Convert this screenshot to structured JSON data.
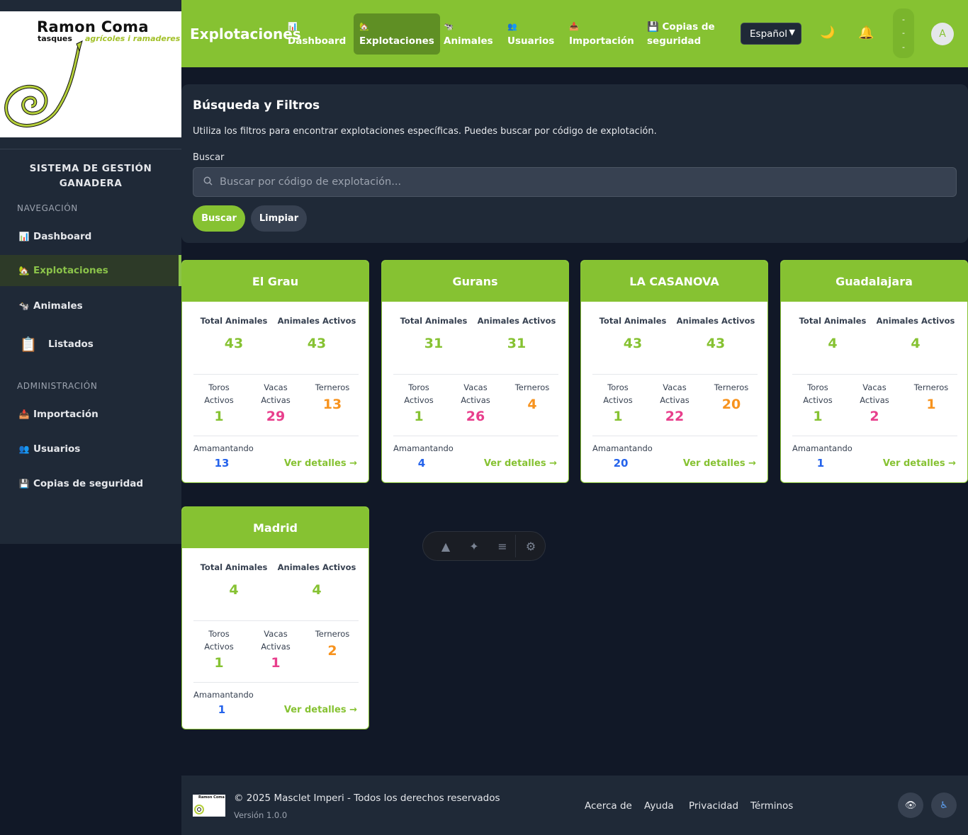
{
  "brand": {
    "name": "Ramon Coma",
    "tagline_left": "tasques",
    "tagline_right": "agrícoles i ramaderes",
    "colors": {
      "green": "#86c232",
      "dark": "#111827",
      "panel": "#1f2937"
    }
  },
  "sidebar": {
    "system_title_line1": "SISTEMA DE GESTIÓN",
    "system_title_line2": "GANADERA",
    "section_nav": "NAVEGACIÓN",
    "section_admin": "ADMINISTRACIÓN",
    "items": [
      {
        "label": "Dashboard",
        "icon": "📊"
      },
      {
        "label": "Explotaciones",
        "icon": "🏡"
      },
      {
        "label": "Animales",
        "icon": "🐄"
      },
      {
        "label": "Listados",
        "icon": "📋"
      },
      {
        "label": "Importación",
        "icon": "📥"
      },
      {
        "label": "Usuarios",
        "icon": "👥"
      },
      {
        "label": "Copias de seguridad",
        "icon": "💾"
      }
    ]
  },
  "header": {
    "title": "Explotaciones",
    "nav": [
      {
        "line1": "📊",
        "line2": "Dashboard"
      },
      {
        "line1": "🏡",
        "line2": "Explotaciones"
      },
      {
        "line1": "🐄",
        "line2": "Animales"
      },
      {
        "line1": "👥",
        "line2": "Usuarios"
      },
      {
        "line1": "📥",
        "line2": "Importación"
      },
      {
        "line1": "💾 Copias de",
        "line2": "seguridad"
      }
    ],
    "language": "Español",
    "moon_icon": "🌙",
    "bell_icon": "🔔",
    "pill_dots": [
      "-",
      "-",
      "-"
    ],
    "avatar_letter": "A"
  },
  "filters": {
    "title": "Búsqueda y Filtros",
    "description": "Utiliza los filtros para encontrar explotaciones específicas. Puedes buscar por código de explotación.",
    "search_label": "Buscar",
    "search_placeholder": "Buscar por código de explotación...",
    "search_value": "",
    "search_button": "Buscar",
    "clear_button": "Limpiar"
  },
  "card_labels": {
    "total": "Total Animales",
    "active": "Animales Activos",
    "toros": "Toros",
    "vacas": "Vacas",
    "activos": "Activos",
    "activas": "Activas",
    "terneros": "Terneros",
    "amamantando": "Amamantando",
    "details": "Ver detalles →"
  },
  "farms": [
    {
      "name": "El Grau",
      "total": "43",
      "active": "43",
      "toros": "1",
      "vacas": "29",
      "terneros": "13",
      "amamantando": "13"
    },
    {
      "name": "Gurans",
      "total": "31",
      "active": "31",
      "toros": "1",
      "vacas": "26",
      "terneros": "4",
      "amamantando": "4"
    },
    {
      "name": "LA CASANOVA",
      "total": "43",
      "active": "43",
      "toros": "1",
      "vacas": "22",
      "terneros": "20",
      "amamantando": "20"
    },
    {
      "name": "Guadalajara",
      "total": "4",
      "active": "4",
      "toros": "1",
      "vacas": "2",
      "terneros": "1",
      "amamantando": "1"
    },
    {
      "name": "Madrid",
      "total": "4",
      "active": "4",
      "toros": "1",
      "vacas": "1",
      "terneros": "2",
      "amamantando": "1"
    }
  ],
  "footer": {
    "copyright": "© 2025 Masclet Imperi - Todos los derechos reservados",
    "version": "Versión 1.0.0",
    "logo_text": "Ramon Coma",
    "links": [
      "Acerca de",
      "Ayuda",
      "Privacidad",
      "Términos"
    ],
    "eye_icon": "👁",
    "accessibility_icon": "♿"
  }
}
